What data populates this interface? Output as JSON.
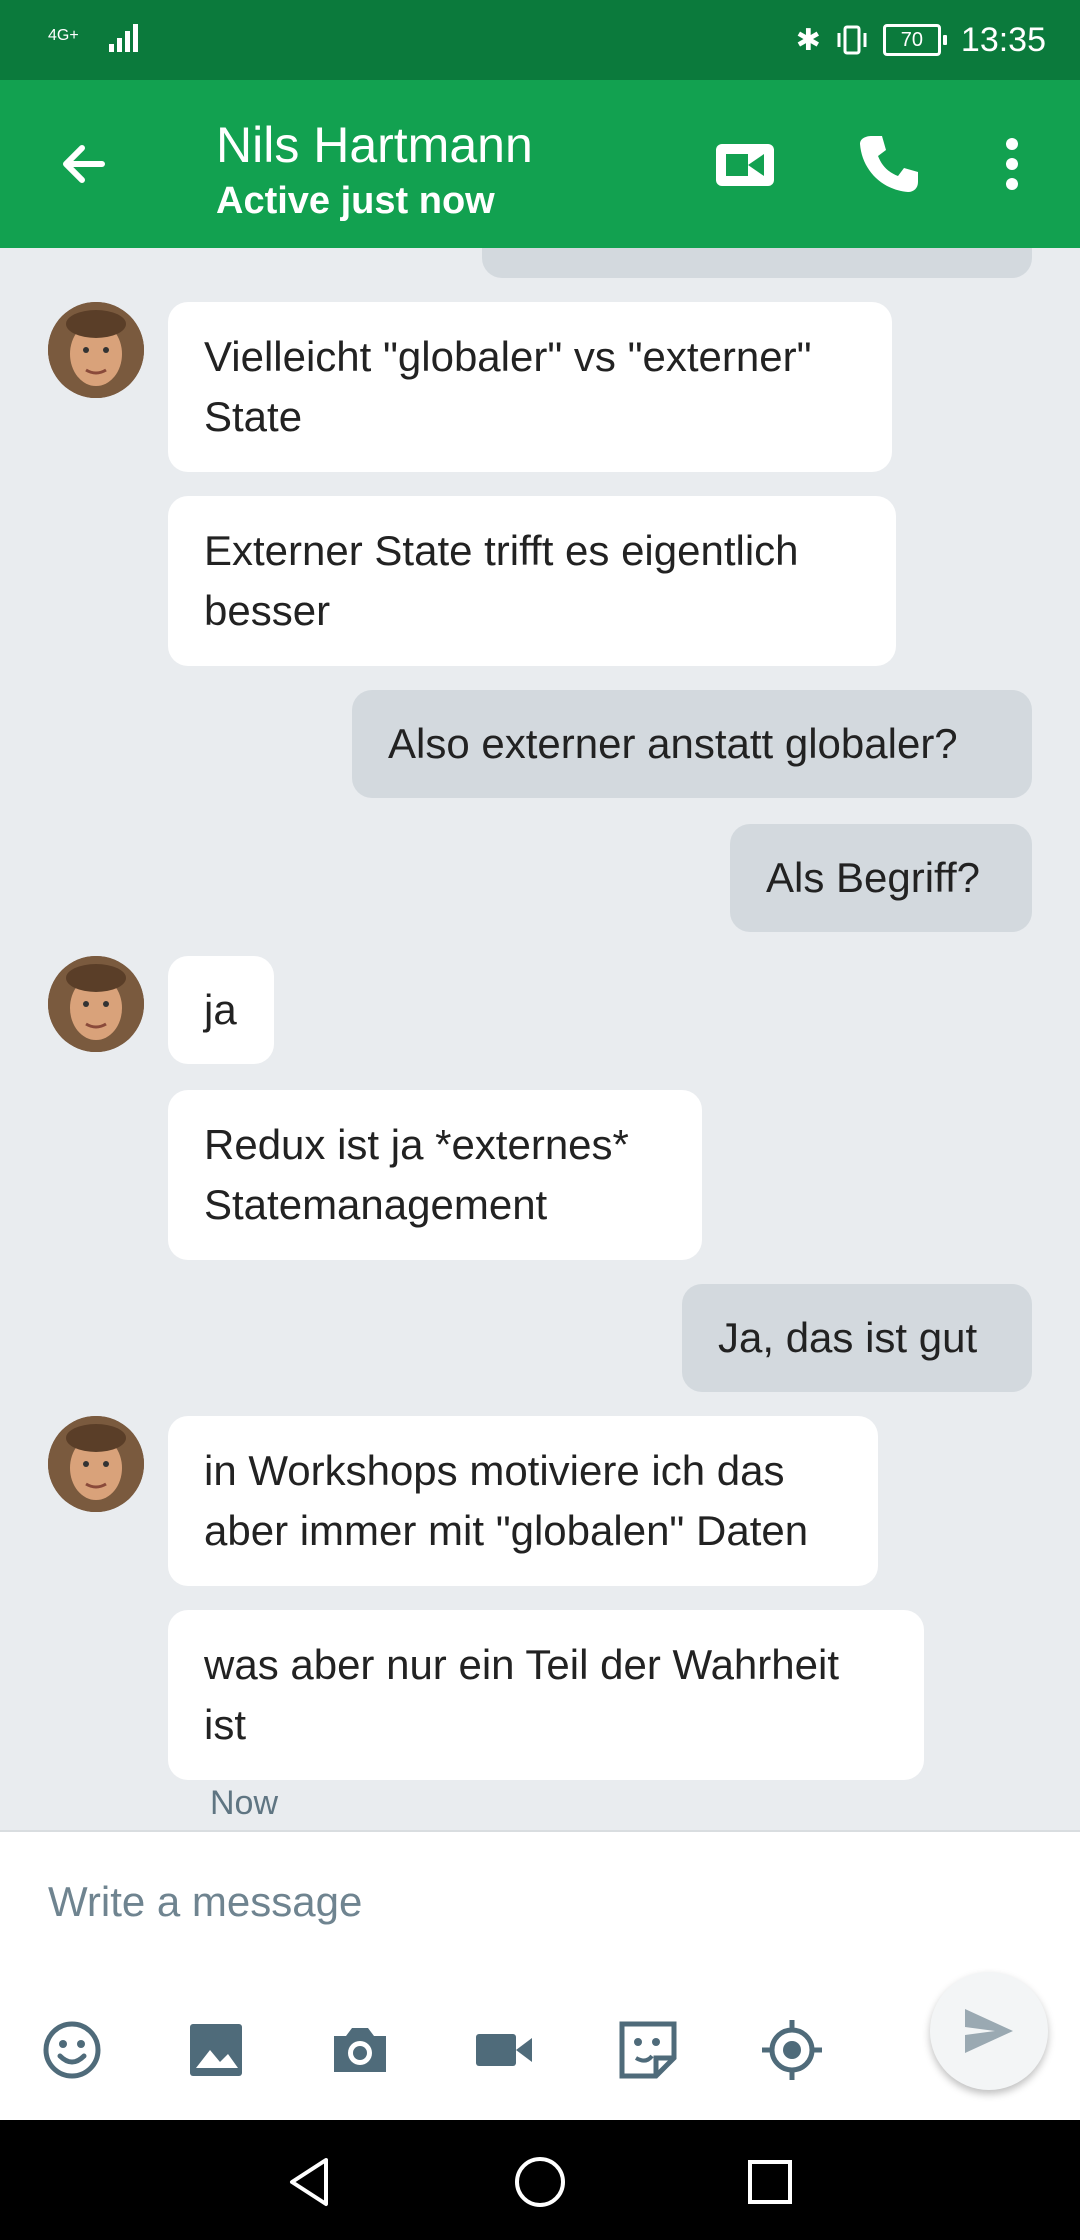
{
  "status": {
    "network": "4G+",
    "battery": "70",
    "time": "13:35"
  },
  "header": {
    "name": "Nils Hartmann",
    "status": "Active just now"
  },
  "messages": [
    {
      "side": "in",
      "text": "Vielleicht \"globaler\" vs \"externer\" State"
    },
    {
      "side": "in",
      "text": "Externer State trifft es eigentlich besser"
    },
    {
      "side": "out",
      "text": "Also externer anstatt globaler?"
    },
    {
      "side": "out",
      "text": "Als Begriff?"
    },
    {
      "side": "in",
      "text": "ja"
    },
    {
      "side": "in",
      "text": "Redux ist ja *externes* Statemanagement"
    },
    {
      "side": "out",
      "text": "Ja, das ist gut"
    },
    {
      "side": "in",
      "text": "in Workshops motiviere ich das aber immer mit \"globalen\" Daten"
    },
    {
      "side": "in",
      "text": "was aber nur ein Teil der Wahrheit ist"
    }
  ],
  "last_time": "Now",
  "composer": {
    "placeholder": "Write a message"
  },
  "colors": {
    "app_bar": "#12a150",
    "status_bar": "#0b7a3c",
    "background": "#e9ecef",
    "incoming_bubble": "#ffffff",
    "outgoing_bubble": "#d3d9de",
    "icon_gray": "#4f6b7a"
  },
  "icons": [
    "back-arrow-icon",
    "video-call-icon",
    "phone-icon",
    "more-vert-icon",
    "emoji-icon",
    "image-icon",
    "camera-icon",
    "video-icon",
    "sticker-icon",
    "location-icon",
    "send-icon",
    "nav-back-icon",
    "nav-home-icon",
    "nav-recents-icon"
  ]
}
